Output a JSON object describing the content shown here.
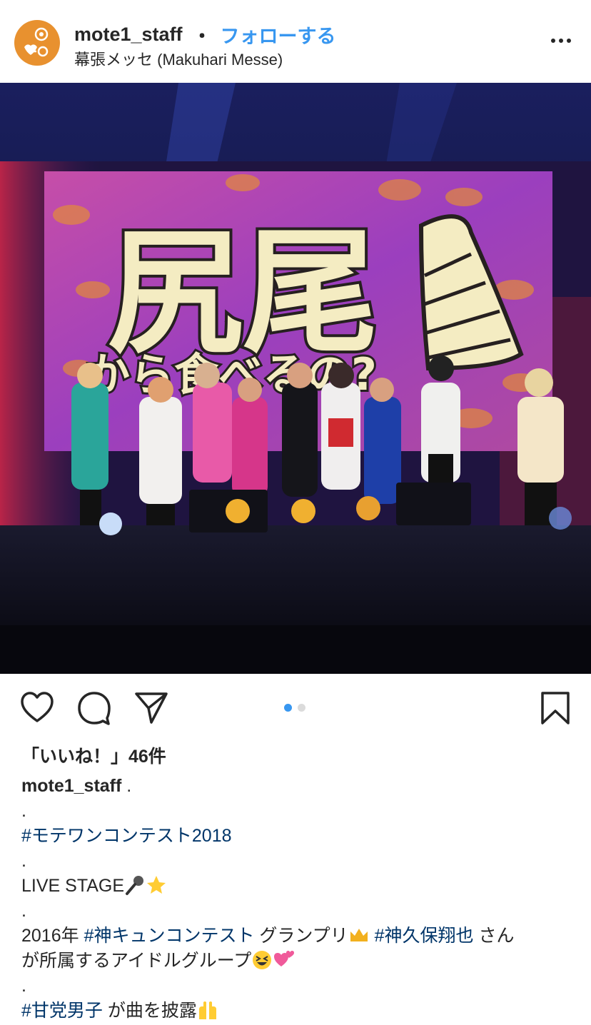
{
  "post": {
    "username": "mote1_staff",
    "separator": "・",
    "follow_label": "フォローする",
    "location": "幕張メッセ (Makuhari Messe)"
  },
  "photo": {
    "screen_text_line1": "尻尾",
    "screen_text_line2": "から食べるの?"
  },
  "pager": {
    "count": 2,
    "active_index": 0,
    "active_color": "#3897f0",
    "inactive_color": "#dbdbdb"
  },
  "likes_label": "「いいね！」46件",
  "caption": {
    "username": "mote1_staff",
    "lines": [
      {
        "text": " ."
      },
      {
        "text": "."
      },
      {
        "hashtag": "#モテワンコンテスト2018"
      },
      {
        "text": "."
      },
      {
        "text": "LIVE STAGE",
        "emojis": [
          "microphone",
          "glowing-star"
        ]
      },
      {
        "text": "."
      },
      {
        "text_a": "2016年 ",
        "hashtag_a": "#神キュンコンテスト",
        "text_b": " グランプリ",
        "emoji_a": "crown",
        "hashtag_b": "#神久保翔也",
        "text_c": " さん"
      },
      {
        "text": "が所属するアイドルグループ",
        "emojis": [
          "grinning-squint",
          "two-hearts"
        ]
      },
      {
        "text": "."
      },
      {
        "hashtag": "#甘党男子",
        "text": " が曲を披露",
        "emojis": [
          "raising-hands"
        ]
      }
    ]
  },
  "colors": {
    "accent": "#3897f0",
    "hashtag": "#003569",
    "text": "#262626",
    "avatar": "#e8912f"
  }
}
